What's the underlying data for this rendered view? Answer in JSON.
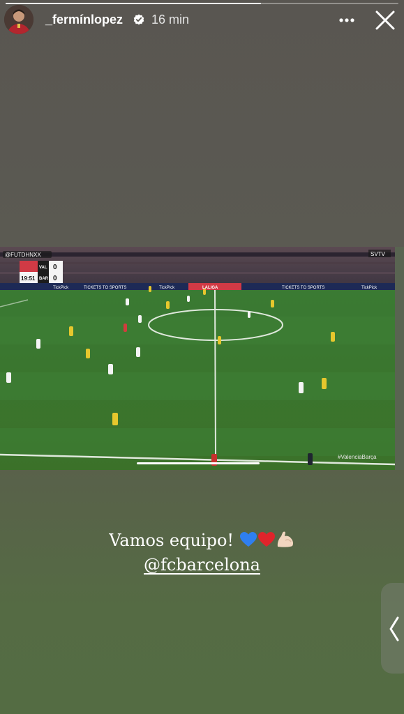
{
  "story": {
    "progress": 0.65,
    "username": "_fermínlopez",
    "time": "16 min"
  },
  "media": {
    "watermark": "@FUTDHNXX",
    "channel": "SVTV",
    "scoreboard": {
      "home_team": "VAL",
      "away_team": "BAR",
      "home_score": "0",
      "away_score": "0",
      "clock": "19:51"
    },
    "board_texts": [
      "TickPick",
      "TICKETS TO SPORTS",
      "TickPick",
      "LALIGA",
      "TICKETS TO SPORTS",
      "TickPick"
    ],
    "hashtag": "#ValenciaBarça"
  },
  "caption": {
    "text": "Vamos equipo!",
    "emojis": [
      "blue-heart",
      "red-heart",
      "flexed-biceps"
    ],
    "mention": "@fcbarcelona"
  },
  "colors": {
    "background_top": "#595651",
    "background_bottom": "#546c43",
    "pitch": "#3d7430",
    "blue_heart": "#2f7ff0",
    "red_heart": "#e0242b",
    "barca_kit": "#e6c72d",
    "valencia_kit": "#f4f4f4"
  }
}
